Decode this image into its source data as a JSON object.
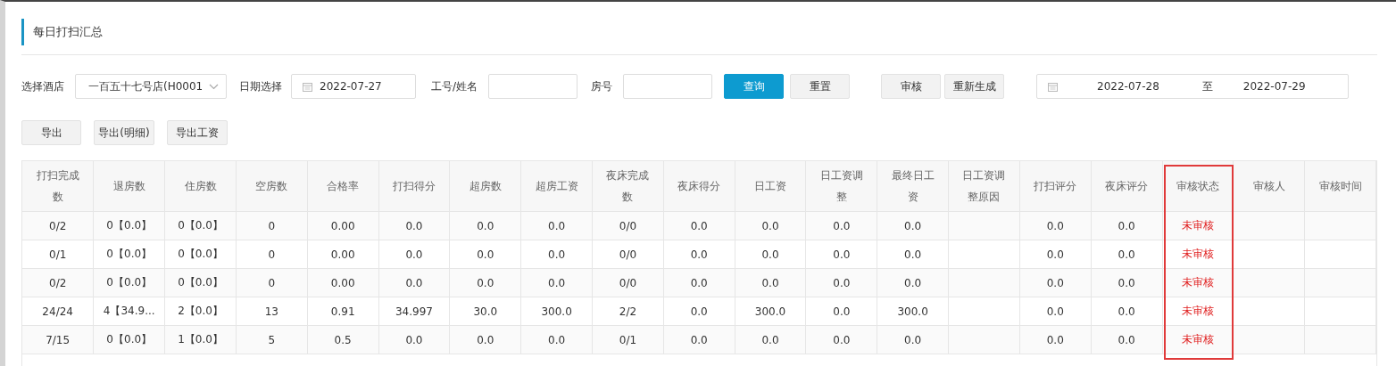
{
  "page_title": "每日打扫汇总",
  "filters": {
    "hotel_label": "选择酒店",
    "hotel_value": "一百五十七号店(H0001",
    "date_label": "日期选择",
    "date_value": "2022-07-27",
    "staff_label": "工号/姓名",
    "room_label": "房号"
  },
  "actions": [
    {
      "label": "查询",
      "kind": "primary"
    },
    {
      "label": "重置",
      "kind": "plain"
    }
  ],
  "review_actions": [
    {
      "label": "审核"
    },
    {
      "label": "重新生成"
    }
  ],
  "date_range": {
    "start": "2022-07-28",
    "separator": "至",
    "end": "2022-07-29"
  },
  "export_buttons": [
    "导出",
    "导出(明细)",
    "导出工资"
  ],
  "table": {
    "columns": [
      {
        "label": "打扫完成数",
        "highlighted": false
      },
      {
        "label": "退房数",
        "highlighted": false
      },
      {
        "label": "住房数",
        "highlighted": false
      },
      {
        "label": "空房数",
        "highlighted": false
      },
      {
        "label": "合格率",
        "highlighted": false
      },
      {
        "label": "打扫得分",
        "highlighted": false
      },
      {
        "label": "超房数",
        "highlighted": false
      },
      {
        "label": "超房工资",
        "highlighted": false
      },
      {
        "label": "夜床完成数",
        "highlighted": false
      },
      {
        "label": "夜床得分",
        "highlighted": false
      },
      {
        "label": "日工资",
        "highlighted": false
      },
      {
        "label": "日工资调整",
        "highlighted": false
      },
      {
        "label": "最终日工资",
        "highlighted": false
      },
      {
        "label": "日工资调整原因",
        "highlighted": false
      },
      {
        "label": "打扫评分",
        "highlighted": false
      },
      {
        "label": "夜床评分",
        "highlighted": false
      },
      {
        "label": "审核状态",
        "highlighted": true
      },
      {
        "label": "审核人",
        "highlighted": false
      },
      {
        "label": "审核时间",
        "highlighted": false
      }
    ],
    "rows": [
      {
        "cells": [
          "0/2",
          "0【0.0】",
          "0【0.0】",
          "0",
          "0.00",
          "0.0",
          "0.0",
          "0.0",
          "0/0",
          "0.0",
          "0.0",
          "0.0",
          "0.0",
          null,
          "0.0",
          "0.0",
          "未审核",
          null,
          null
        ],
        "reviewed": false
      },
      {
        "cells": [
          "0/1",
          "0【0.0】",
          "0【0.0】",
          "0",
          "0.00",
          "0.0",
          "0.0",
          "0.0",
          "0/0",
          "0.0",
          "0.0",
          "0.0",
          "0.0",
          null,
          "0.0",
          "0.0",
          "未审核",
          null,
          null
        ],
        "reviewed": false
      },
      {
        "cells": [
          "0/2",
          "0【0.0】",
          "0【0.0】",
          "0",
          "0.00",
          "0.0",
          "0.0",
          "0.0",
          "0/0",
          "0.0",
          "0.0",
          "0.0",
          "0.0",
          null,
          "0.0",
          "0.0",
          "未审核",
          null,
          null
        ],
        "reviewed": false
      },
      {
        "cells": [
          "24/24",
          "4【34.9...",
          "2【0.0】",
          "13",
          "0.91",
          "34.997",
          "30.0",
          "300.0",
          "2/2",
          "0.0",
          "300.0",
          "0.0",
          "300.0",
          null,
          "0.0",
          "0.0",
          "未审核",
          null,
          null
        ],
        "reviewed": false
      },
      {
        "cells": [
          "7/15",
          "0【0.0】",
          "1【0.0】",
          "5",
          "0.5",
          "0.0",
          "0.0",
          "0.0",
          "0/1",
          "0.0",
          "0.0",
          "0.0",
          "0.0",
          null,
          "0.0",
          "0.0",
          "未审核",
          null,
          null
        ],
        "reviewed": false
      }
    ]
  }
}
